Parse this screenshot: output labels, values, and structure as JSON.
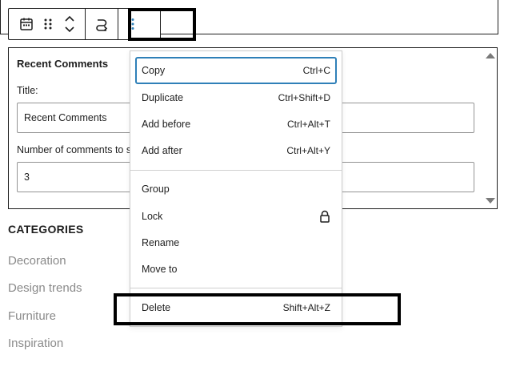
{
  "toolbar": {
    "buttons": [
      "calendar-icon",
      "drag-handle-icon",
      "move-up-down-icon",
      "transform-icon",
      "options-icon"
    ]
  },
  "widget": {
    "title": "Recent Comments",
    "title_label": "Title:",
    "title_value": "Recent Comments",
    "count_label": "Number of comments to sh",
    "count_value": "3"
  },
  "categories": {
    "heading": "CATEGORIES",
    "items": [
      "Decoration",
      "Design trends",
      "Furniture",
      "Inspiration"
    ]
  },
  "menu": {
    "items": [
      {
        "label": "Copy",
        "shortcut": "Ctrl+C"
      },
      {
        "label": "Duplicate",
        "shortcut": "Ctrl+Shift+D"
      },
      {
        "label": "Add before",
        "shortcut": "Ctrl+Alt+T"
      },
      {
        "label": "Add after",
        "shortcut": "Ctrl+Alt+Y"
      },
      {
        "label": "Group",
        "shortcut": ""
      },
      {
        "label": "Lock",
        "shortcut": ""
      },
      {
        "label": "Rename",
        "shortcut": ""
      },
      {
        "label": "Move to",
        "shortcut": ""
      },
      {
        "label": "Delete",
        "shortcut": "Shift+Alt+Z"
      }
    ]
  },
  "colors": {
    "focus_ring": "#2f80b8",
    "options_icon": "#2f80b8",
    "category_link": "#8a8a8a",
    "highlight_box": "#000000"
  }
}
